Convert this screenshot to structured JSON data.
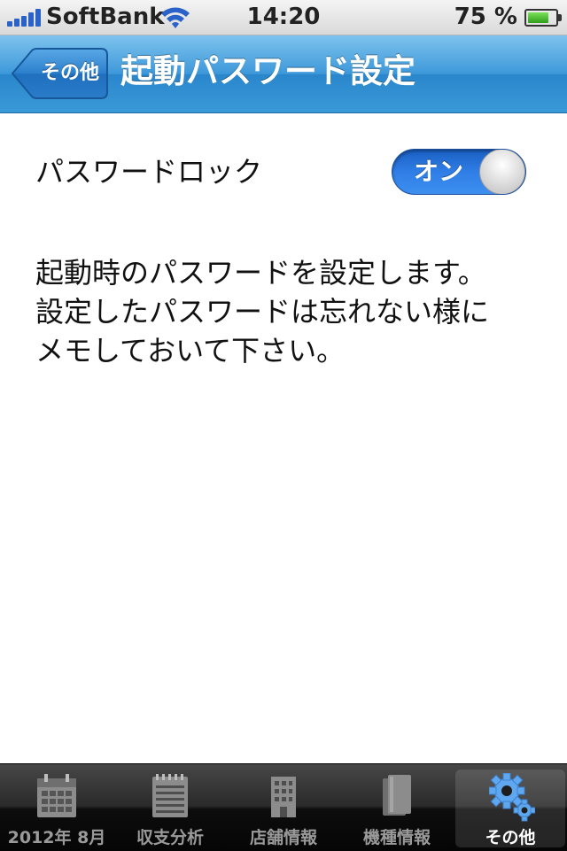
{
  "status_bar": {
    "carrier": "SoftBank",
    "time": "14:20",
    "battery_percent": "75 %",
    "battery_level": 0.75
  },
  "nav": {
    "back_label": "その他",
    "title": "起動パスワード設定"
  },
  "settings": {
    "password_lock_label": "パスワードロック",
    "password_lock_state": "オン"
  },
  "description": {
    "lines": [
      "起動時のパスワードを設定します。",
      "設定したパスワードは忘れない様に",
      "メモしておいて下さい。"
    ]
  },
  "tab_bar": {
    "tabs": [
      {
        "label": "2012年 8月",
        "icon": "calendar-icon"
      },
      {
        "label": "収支分析",
        "icon": "notepad-icon"
      },
      {
        "label": "店舗情報",
        "icon": "building-icon"
      },
      {
        "label": "機種情報",
        "icon": "books-icon"
      },
      {
        "label": "その他",
        "icon": "gear-icon"
      }
    ],
    "selected_index": 4
  },
  "colors": {
    "nav_blue": "#3a9ad8",
    "toggle_blue": "#2f7ee6",
    "tab_selected": "#ffffff"
  }
}
